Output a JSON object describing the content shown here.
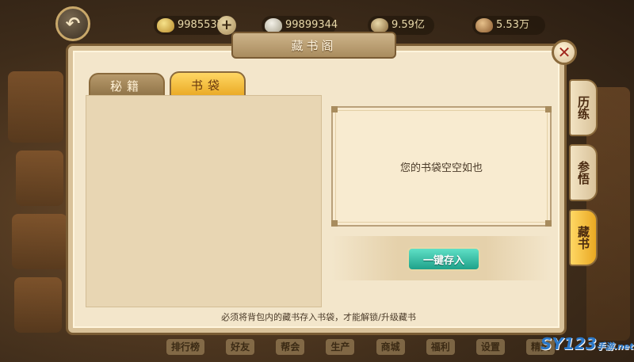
{
  "top_bar": {
    "currencies": [
      {
        "value": "99855370",
        "icon": "gold-ingot-icon"
      },
      {
        "value": "99899344",
        "icon": "silver-ingot-icon"
      },
      {
        "value": "9.59亿",
        "icon": "coin-pouch-icon"
      },
      {
        "value": "5.53万",
        "icon": "scroll-icon"
      }
    ],
    "back_icon": "back-arrow-icon"
  },
  "dialog": {
    "title": "藏书阁",
    "close_icon": "close-icon",
    "tabs": [
      {
        "label": "秘籍",
        "active": false
      },
      {
        "label": "书袋",
        "active": true
      }
    ],
    "empty_message": "您的书袋空空如也",
    "store_button": "一键存入",
    "footer_note": "必须将背包内的藏书存入书袋，才能解锁/升级藏书"
  },
  "side_tabs": [
    {
      "label": "历练",
      "active": false
    },
    {
      "label": "参悟",
      "active": false
    },
    {
      "label": "藏书",
      "active": true
    }
  ],
  "bottom_nav": [
    "排行榜",
    "好友",
    "帮会",
    "生产",
    "商城",
    "福利",
    "设置",
    "精灵"
  ],
  "watermark": {
    "main": "SY123",
    "sub": "手游",
    "suffix": ".net"
  },
  "colors": {
    "panel_bg": "#f3e6cb",
    "active_tab": "#e9a822",
    "store_button": "#1fa18a"
  }
}
